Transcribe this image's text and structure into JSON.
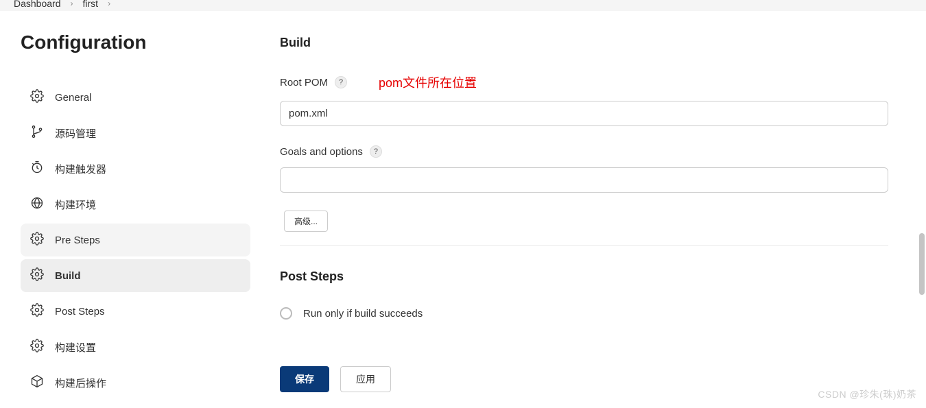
{
  "breadcrumb": {
    "items": [
      "Dashboard",
      "first"
    ]
  },
  "sidebar": {
    "title": "Configuration",
    "items": [
      {
        "label": "General",
        "icon": "gear"
      },
      {
        "label": "源码管理",
        "icon": "branch"
      },
      {
        "label": "构建触发器",
        "icon": "clock"
      },
      {
        "label": "构建环境",
        "icon": "globe"
      },
      {
        "label": "Pre Steps",
        "icon": "gear",
        "selected": true
      },
      {
        "label": "Build",
        "icon": "gear",
        "active": true
      },
      {
        "label": "Post Steps",
        "icon": "gear"
      },
      {
        "label": "构建设置",
        "icon": "gear"
      },
      {
        "label": "构建后操作",
        "icon": "box"
      }
    ]
  },
  "main": {
    "build": {
      "title": "Build",
      "root_pom_label": "Root POM",
      "root_pom_value": "pom.xml",
      "annotation": "pom文件所在位置",
      "goals_label": "Goals and options",
      "goals_value": "",
      "advanced_btn": "高级..."
    },
    "post_steps": {
      "title": "Post Steps",
      "radio1": "Run only if build succeeds"
    },
    "footer": {
      "save": "保存",
      "apply": "应用"
    }
  },
  "watermark": "CSDN @珍朱(珠)奶茶"
}
